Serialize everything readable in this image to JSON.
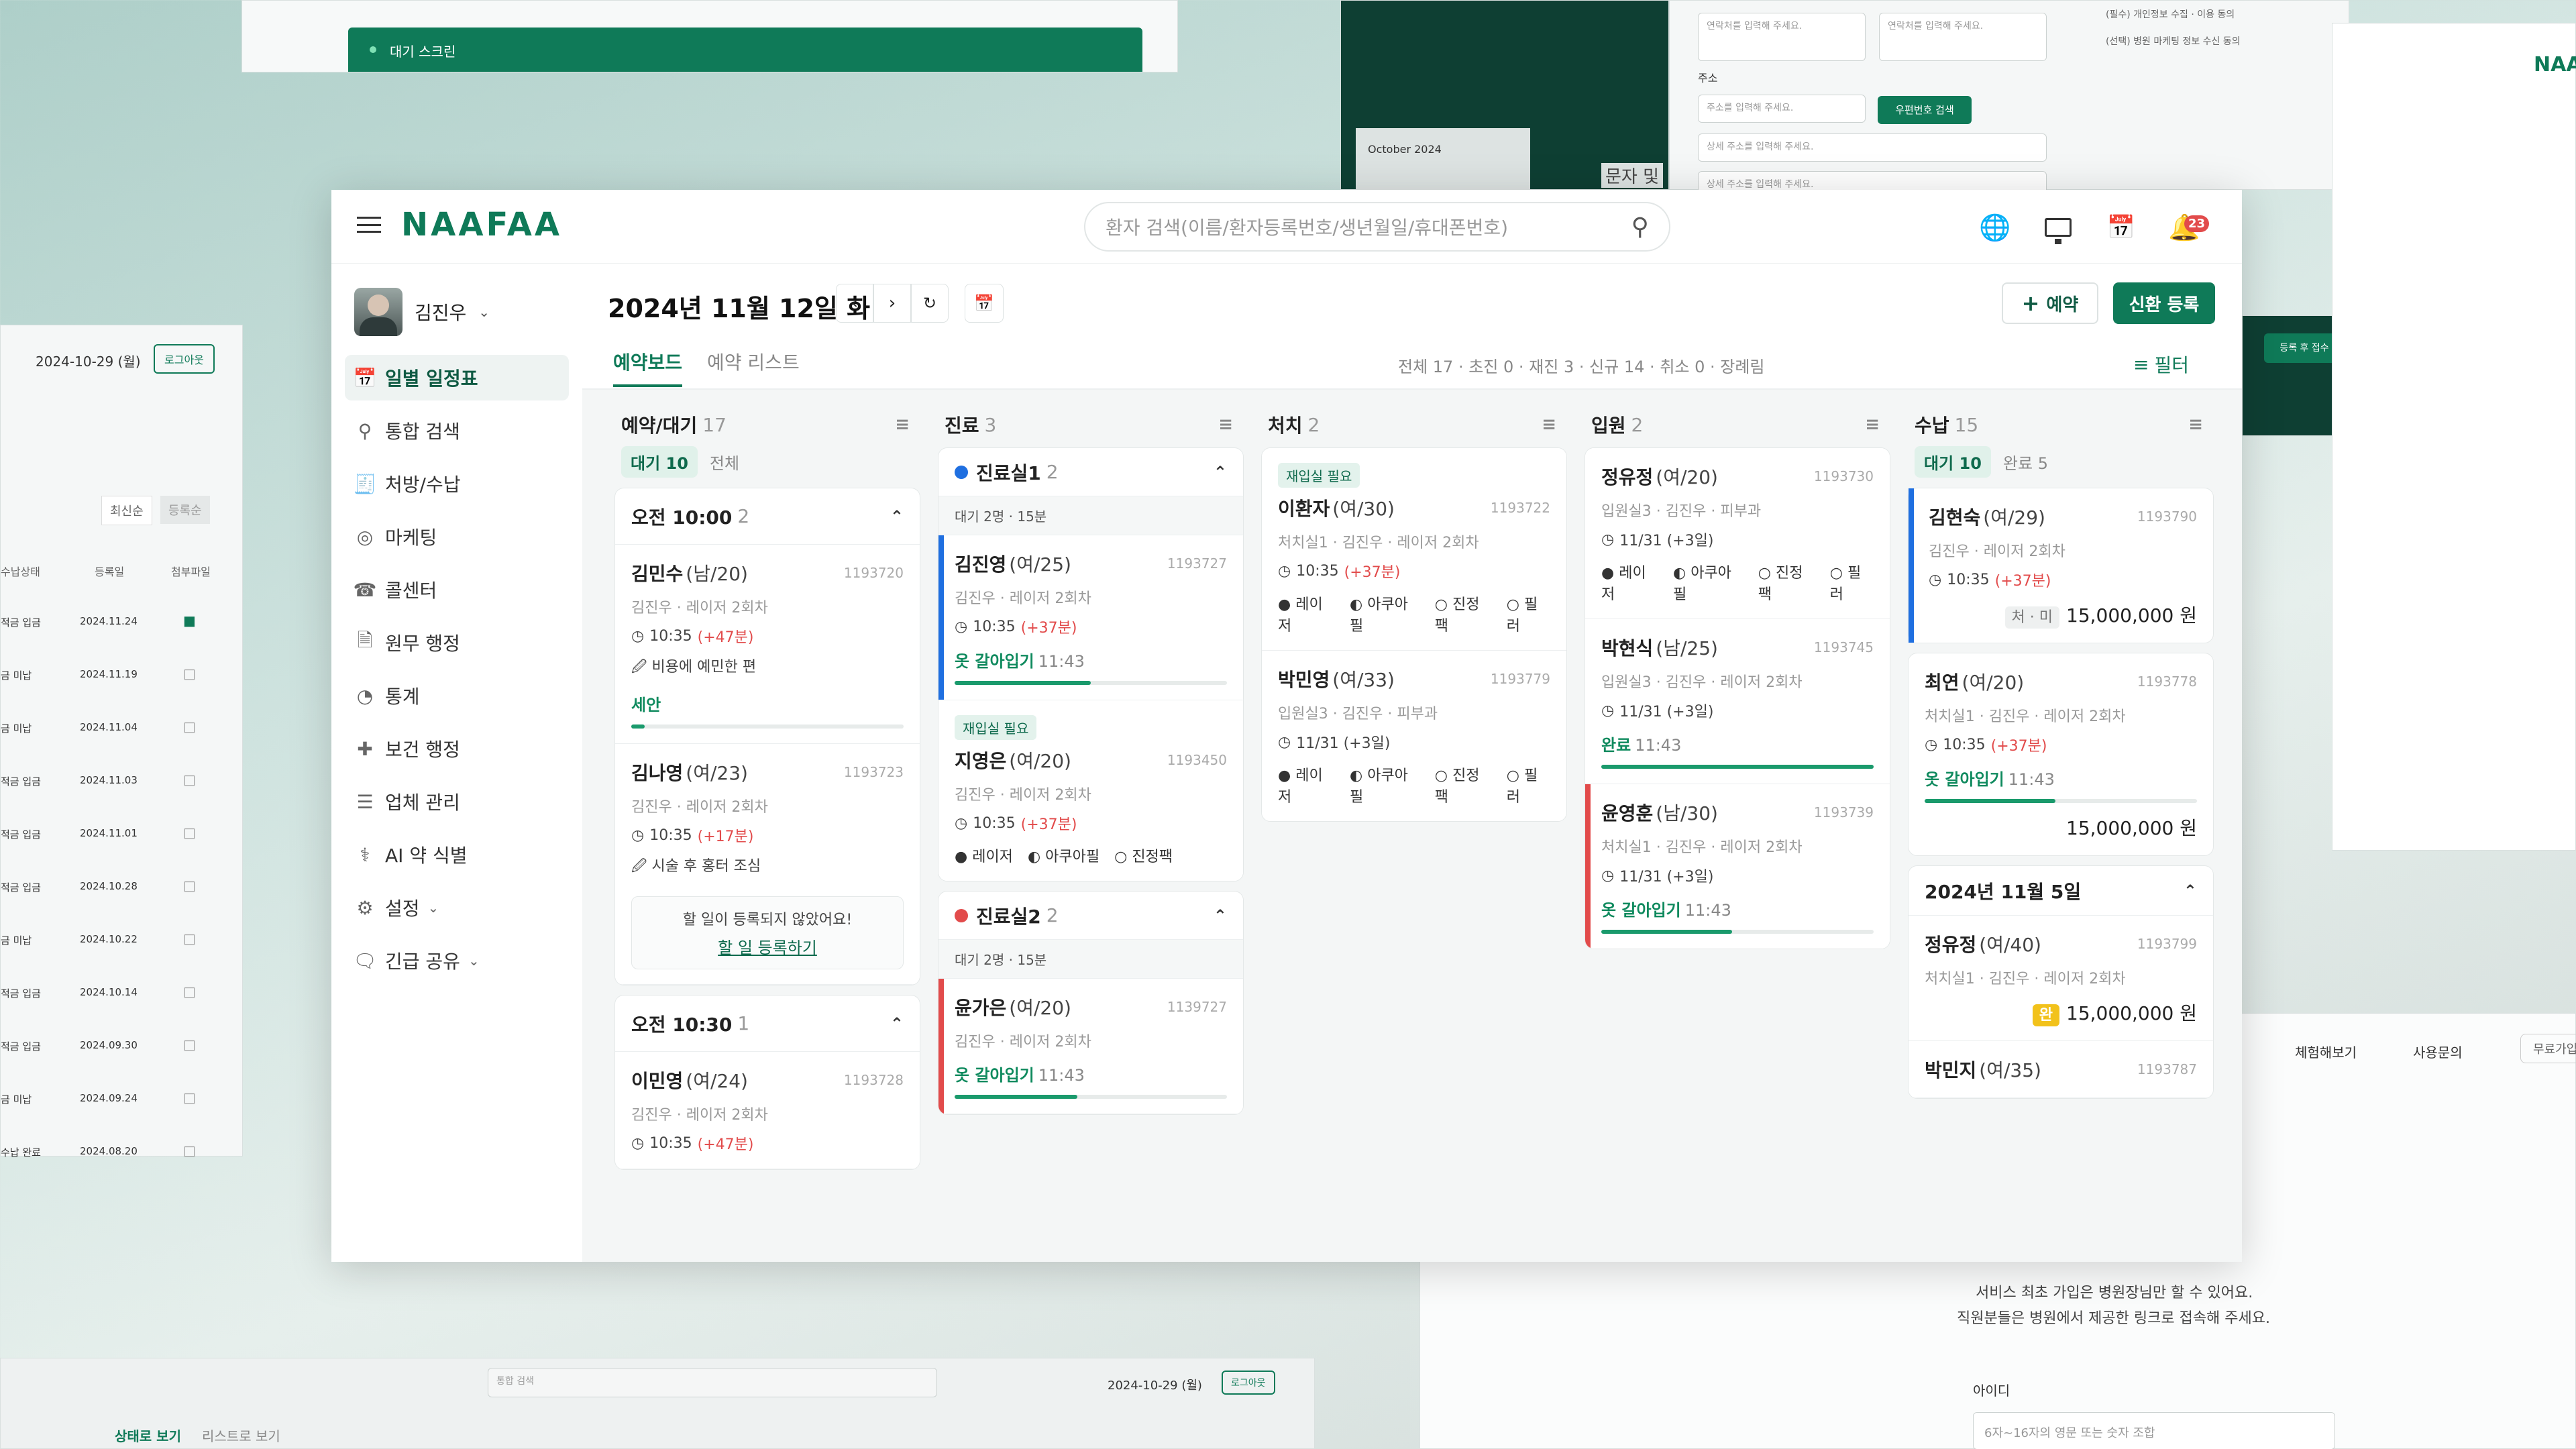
{
  "bg": {
    "waiting_screen": "대기 스크린",
    "left_date": "2024-10-29 (월)",
    "left_logout": "로그아웃",
    "left_sort_a": "최신순",
    "left_sort_b": "등록순",
    "left_cols": [
      "수납상태",
      "등록일",
      "첨부파일"
    ],
    "left_rows": [
      [
        "적금 입금",
        "2024.11.24"
      ],
      [
        "금 미납",
        "2024.11.19"
      ],
      [
        "금 미납",
        "2024.11.04"
      ],
      [
        "적금 입금",
        "2024.11.03"
      ],
      [
        "적금 입금",
        "2024.11.01"
      ],
      [
        "적금 입금",
        "2024.10.28"
      ],
      [
        "금 미납",
        "2024.10.22"
      ],
      [
        "적금 입금",
        "2024.10.14"
      ],
      [
        "적금 입금",
        "2024.09.30"
      ],
      [
        "금 미납",
        "2024.09.24"
      ],
      [
        "수납 완료",
        "2024.08.20"
      ]
    ],
    "cal_month": "October 2024",
    "cal_label": "문자 및",
    "form_phone_ph": "연락처를 입력해 주세요.",
    "form_addr_label": "주소",
    "form_addr_ph": "주소를 입력해 주세요.",
    "form_post_btn": "우편번호 검색",
    "form_detail_ph": "상세 주소를 입력해 주세요.",
    "agree_a": "(필수) 개인정보 수집 · 이용 동의",
    "agree_b": "(선택) 병원 마케팅 정보 수신 동의",
    "right_btn": "등록 후 접수",
    "nav_try": "체험해보기",
    "nav_ask": "사용문의",
    "nav_free": "무료가입",
    "signup_note1": "서비스 최초 가입은 병원장님만 할 수 있어요.",
    "signup_note2": "직원분들은 병원에서 제공한 링크로 접속해 주세요.",
    "signup_id": "아이디",
    "signup_id_ph": "6자~16자의 영문 또는 숫자 조합",
    "bottom_search": "통합 검색",
    "bottom_date": "2024-10-29 (월)",
    "bottom_logout": "로그아웃",
    "bottom_tab_a": "상태로 보기",
    "bottom_tab_b": "리스트로 보기"
  },
  "app": {
    "logo": "NAAFAA",
    "search_placeholder": "환자 검색(이름/환자등록번호/생년월일/휴대폰번호)",
    "notif_count": "23",
    "user": "김진우",
    "nav": [
      {
        "label": "일별 일정표",
        "icon": "calendar-icon"
      },
      {
        "label": "통합 검색",
        "icon": "search-icon"
      },
      {
        "label": "처방/수납",
        "icon": "receipt-icon"
      },
      {
        "label": "마케팅",
        "icon": "marketing-icon"
      },
      {
        "label": "콜센터",
        "icon": "phone-icon"
      },
      {
        "label": "원무 행정",
        "icon": "document-icon"
      },
      {
        "label": "통계",
        "icon": "chart-icon"
      },
      {
        "label": "보건 행정",
        "icon": "health-icon"
      },
      {
        "label": "업체 관리",
        "icon": "list-icon"
      },
      {
        "label": "AI 약 식별",
        "icon": "pill-icon"
      },
      {
        "label": "설정",
        "icon": "gear-icon"
      },
      {
        "label": "긴급 공유",
        "icon": "share-icon"
      }
    ],
    "date_title": "2024년 11월 12일 화",
    "btn_reserve": "예약",
    "btn_new": "신환 등록",
    "tab_board": "예약보드",
    "tab_list": "예약 리스트",
    "summary": "전체 17 · 초진 0 · 재진 3 · 신규 14 · 취소 0 · 장례림",
    "filter": "필터"
  },
  "cols": {
    "c1": {
      "title": "예약/대기",
      "count": "17",
      "chip_on": "대기 10",
      "chip_off": "전체",
      "g1": {
        "title": "오전 10:00",
        "count": "2"
      },
      "g1c1": {
        "name": "김민수",
        "age": "(남/20)",
        "id": "1193720",
        "sub": "김진우 · 레이저 2회차",
        "time": "10:35",
        "late": "(+47분)",
        "note": "비용에 예민한 편",
        "stat": "세안",
        "fill": 0.05
      },
      "g1c2": {
        "name": "김나영",
        "age": "(여/23)",
        "id": "1193723",
        "sub": "김진우 · 레이저 2회차",
        "time": "10:35",
        "late": "(+17분)",
        "note": "시술 후 홍터 조심",
        "empty": "할 일이 등록되지 않았어요!",
        "empty_link": "할 일 등록하기"
      },
      "g2": {
        "title": "오전 10:30",
        "count": "1"
      },
      "g2c1": {
        "name": "이민영",
        "age": "(여/24)",
        "id": "1193728",
        "sub": "김진우 · 레이저 2회차",
        "time": "10:35",
        "late": "(+47분)"
      }
    },
    "c2": {
      "title": "진료",
      "count": "3",
      "r1": {
        "title": "진료실1",
        "count": "2",
        "wait": "대기 2명 · 15분"
      },
      "r1c1": {
        "name": "김진영",
        "age": "(여/25)",
        "id": "1193727",
        "sub": "김진우 · 레이저 2회차",
        "time": "10:35",
        "late": "(+37분)",
        "stat": "옷 갈아입기",
        "st_time": "11:43",
        "fill": 0.5
      },
      "r1c2": {
        "tag": "재입실 필요",
        "name": "지영은",
        "age": "(여/20)",
        "id": "1193450",
        "sub": "김진우 · 레이저 2회차",
        "time": "10:35",
        "late": "(+37분)",
        "opts": [
          "레이저",
          "아쿠아필",
          "진정팩"
        ]
      },
      "r2": {
        "title": "진료실2",
        "count": "2",
        "wait": "대기 2명 · 15분"
      },
      "r2c1": {
        "name": "윤가은",
        "age": "(여/20)",
        "id": "1139727",
        "sub": "김진우 · 레이저 2회차",
        "stat": "옷 갈아입기",
        "st_time": "11:43",
        "fill": 0.45
      }
    },
    "c3": {
      "title": "처치",
      "count": "2",
      "k1": {
        "tag": "재입실 필요",
        "name": "이환자",
        "age": "(여/30)",
        "id": "1193722",
        "sub": "처치실1 · 김진우 · 레이저 2회차",
        "time": "10:35",
        "late": "(+37분)",
        "opts": [
          "레이저",
          "아쿠아필",
          "진정팩",
          "필러"
        ]
      },
      "k2": {
        "name": "박민영",
        "age": "(여/33)",
        "id": "1193779",
        "sub": "입원실3 · 김진우 · 피부과",
        "time": "11/31 (+3일)",
        "opts": [
          "레이저",
          "아쿠아필",
          "진정팩",
          "필러"
        ]
      }
    },
    "c4": {
      "title": "입원",
      "count": "2",
      "h1": {
        "name": "정유정",
        "age": "(여/20)",
        "id": "1193730",
        "sub": "입원실3 · 김진우 · 피부과",
        "time": "11/31 (+3일)",
        "opts": [
          "레이저",
          "아쿠아필",
          "진정팩",
          "필러"
        ]
      },
      "h2": {
        "name": "박현식",
        "age": "(남/25)",
        "id": "1193745",
        "sub": "입원실3 · 김진우 · 레이저 2회차",
        "time": "11/31 (+3일)",
        "stat": "완료",
        "st_time": "11:43",
        "fill": 1
      },
      "h3": {
        "name": "윤영훈",
        "age": "(남/30)",
        "id": "1193739",
        "sub": "처치실1 · 김진우 · 레이저 2회차",
        "time": "11/31 (+3일)",
        "stat": "옷 갈아입기",
        "st_time": "11:43",
        "fill": 0.48
      }
    },
    "c5": {
      "title": "수납",
      "count": "15",
      "chip_on": "대기 10",
      "chip_off": "완료 5",
      "p1": {
        "name": "김현숙",
        "age": "(여/29)",
        "id": "1193790",
        "sub": "김진우 · 레이저 2회차",
        "time": "10:35",
        "late": "(+37분)",
        "badge": "처 · 미",
        "amount": "15,000,000 원"
      },
      "p2": {
        "name": "최연",
        "age": "(여/20)",
        "id": "1193778",
        "sub": "처치실1 · 김진우 · 레이저 2회차",
        "time": "10:35",
        "late": "(+37분)",
        "stat": "옷 갈아입기",
        "st_time": "11:43",
        "fill": 0.48,
        "amount": "15,000,000 원"
      },
      "g": {
        "title": "2024년 11월 5일"
      },
      "p3": {
        "name": "정유정",
        "age": "(여/40)",
        "id": "1193799",
        "sub": "처치실1 · 김진우 · 레이저 2회차",
        "badge": "완",
        "amount": "15,000,000 원"
      },
      "p4": {
        "name": "박민지",
        "age": "(여/35)",
        "id": "1193787"
      }
    }
  },
  "colors": {
    "accent": "#0f7a58",
    "late": "#e24b4b",
    "blue": "#1f6fe0"
  }
}
